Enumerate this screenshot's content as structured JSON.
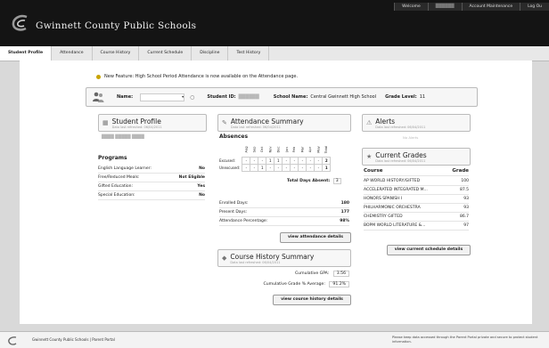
{
  "toplinks": {
    "welcome": "Welcome",
    "user": "██████",
    "account": "Account Maintenance",
    "logout": "Log Ou"
  },
  "brand": "Gwinnett County Public Schools",
  "nav": {
    "tabs": [
      "Student Profile",
      "Attendance",
      "Course History",
      "Current Schedule",
      "Discipline",
      "Test History"
    ]
  },
  "notice": "New Feature: High School Period Attendance is now available on the Attendance page.",
  "idbar": {
    "name_label": "Name:",
    "id_label": "Student ID:",
    "school_label": "School Name:",
    "school_value": "Central Gwinnett High School",
    "grade_label": "Grade Level:",
    "grade_value": "11"
  },
  "profile": {
    "title": "Student Profile",
    "refreshed": "Data last refreshed: 06/04/2011",
    "student_name": "████ █████ ████",
    "programs_heading": "Programs",
    "programs": [
      {
        "label": "English Language Learner:",
        "value": "No"
      },
      {
        "label": "Free/Reduced Meals:",
        "value": "Not Eligible"
      },
      {
        "label": "Gifted Education:",
        "value": "Yes"
      },
      {
        "label": "Special Education:",
        "value": "No"
      }
    ]
  },
  "attendance": {
    "title": "Attendance Summary",
    "refreshed": "Data last refreshed: 06/04/2011",
    "absences_heading": "Absences",
    "months": [
      "Aug",
      "Sep",
      "Oct",
      "Nov",
      "Dec",
      "Jan",
      "Feb",
      "Mar",
      "Apr",
      "May",
      "Total"
    ],
    "excused_label": "Excused:",
    "excused": [
      "-",
      "-",
      "-",
      "1",
      "1",
      "-",
      "-",
      "-",
      "-",
      "-",
      "2"
    ],
    "unexcused_label": "Unexcused:",
    "unexcused": [
      "-",
      "-",
      "1",
      "-",
      "-",
      "-",
      "-",
      "-",
      "-",
      "-",
      "1"
    ],
    "total_label": "Total Days Absent:",
    "total_value": "3",
    "stats": [
      {
        "label": "Enrolled Days:",
        "value": "180"
      },
      {
        "label": "Present Days:",
        "value": "177"
      },
      {
        "label": "Attendance Percentage:",
        "value": "98%"
      }
    ],
    "button": "view attendance details"
  },
  "history": {
    "title": "Course History Summary",
    "refreshed": "Data last refreshed: 06/04/2011",
    "gpa_label": "Cumulative GPA:",
    "gpa_value": "3.56",
    "grade_avg_label": "Cumulative Grade % Average:",
    "grade_avg_value": "91.2%",
    "button": "view course history details"
  },
  "alerts": {
    "title": "Alerts",
    "refreshed": "Data last refreshed: 06/04/2011",
    "none": "No Alerts"
  },
  "grades": {
    "title": "Current Grades",
    "refreshed": "Data last refreshed: 06/04/2011",
    "col_course": "Course",
    "col_grade": "Grade",
    "rows": [
      {
        "course": "AP WORLD HISTORY/GIFTED",
        "grade": "100"
      },
      {
        "course": "ACCELERATED INTEGRATED M...",
        "grade": "87.5"
      },
      {
        "course": "HONORS SPANISH I",
        "grade": "93"
      },
      {
        "course": "PHILHARMONIC ORCHESTRA",
        "grade": "93"
      },
      {
        "course": "CHEMISTRY GIFTED",
        "grade": "86.7"
      },
      {
        "course": "BOPM WORLD LITERATURE &...",
        "grade": "97"
      }
    ],
    "button": "view current schedule details"
  },
  "footer": {
    "left": "Gwinnett County Public Schools | Parent Portal",
    "right": "Please keep data accessed through the Parent Portal private and secure to protect student information."
  }
}
